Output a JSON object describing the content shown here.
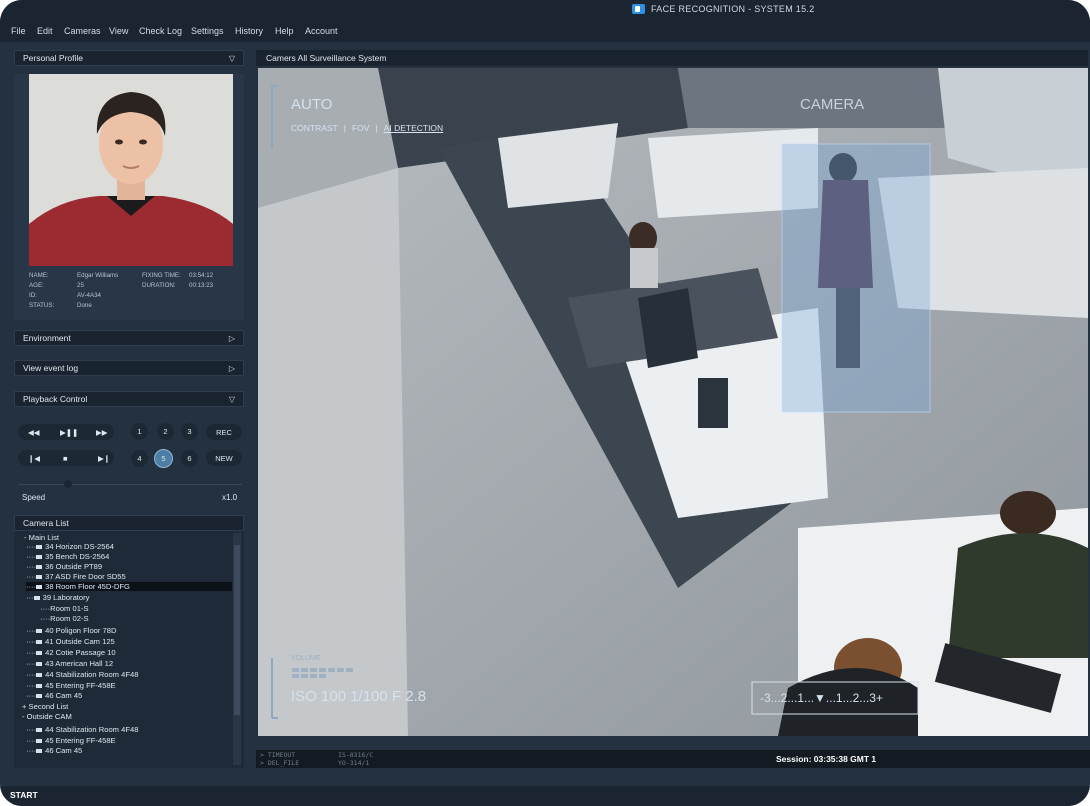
{
  "app": {
    "title": "FACE RECOGNITION - SYSTEM 15.2"
  },
  "menu": [
    "File",
    "Edit",
    "Cameras",
    "View",
    "Check Log",
    "Settings",
    "History",
    "Help",
    "Account"
  ],
  "profile": {
    "header": "Personal Profile",
    "name_label": "NAME:",
    "name": "Edgar Williams",
    "age_label": "AGE:",
    "age": "25",
    "id_label": "ID:",
    "id": "AV-4A34",
    "status_label": "STATUS:",
    "status": "Done",
    "fixing_label": "FIXING TIME:",
    "fixing": "03:54:12",
    "duration_label": "DURATION:",
    "duration": "00:13:23"
  },
  "panels": {
    "environment": "Environment",
    "event_log": "View event log",
    "playback": "Playback Control"
  },
  "playback": {
    "numbers_row1": [
      "1",
      "2",
      "3"
    ],
    "rec": "REC",
    "numbers_row2": [
      "4",
      "5",
      "6"
    ],
    "new": "NEW",
    "selected": "5",
    "speed_label": "Speed",
    "speed_value": "x1.0"
  },
  "camera_list": {
    "header": "Camera List",
    "items": [
      "Main List",
      "34 Horizon DS-2564",
      "35 Bench DS-2564",
      "36 Outside PT89",
      "37 ASD Fire Door SD55",
      "38 Room Floor 45D-DFG",
      "39 Laboratory",
      "Room 01-S",
      "Room 02-S",
      "40 Poligon Floor 78D",
      "41 Outside Cam 125",
      "42 Cotie Passage 10",
      "43 American Hall 12",
      "44 Stabilization Room 4F48",
      "45 Entering FF-458E",
      "46 Cam 45",
      "Second List",
      "Outside CAM",
      "44 Stabilization Room 4F48",
      "45 Entering FF-458E",
      "46 Cam 45"
    ]
  },
  "viewer": {
    "header": "Camers All Surveillance System",
    "auto": "AUTO",
    "camera": "CAMERA",
    "mode_contrast": "CONTRAST",
    "mode_fov": "FOV",
    "mode_ai": "AI DETECTION",
    "volume": "VOLUME",
    "exposure": "ISO 100 1/100 F 2.8",
    "scale": "-3...2...1...▼...1...2...3+"
  },
  "statusbar": {
    "line1": "> TIMEOUT",
    "line2": "> DEL_FILE",
    "code1": "IS-8316/C",
    "code2": "YO-314/1",
    "session": "Session: 03:35:38 GMT 1"
  },
  "start": "START"
}
